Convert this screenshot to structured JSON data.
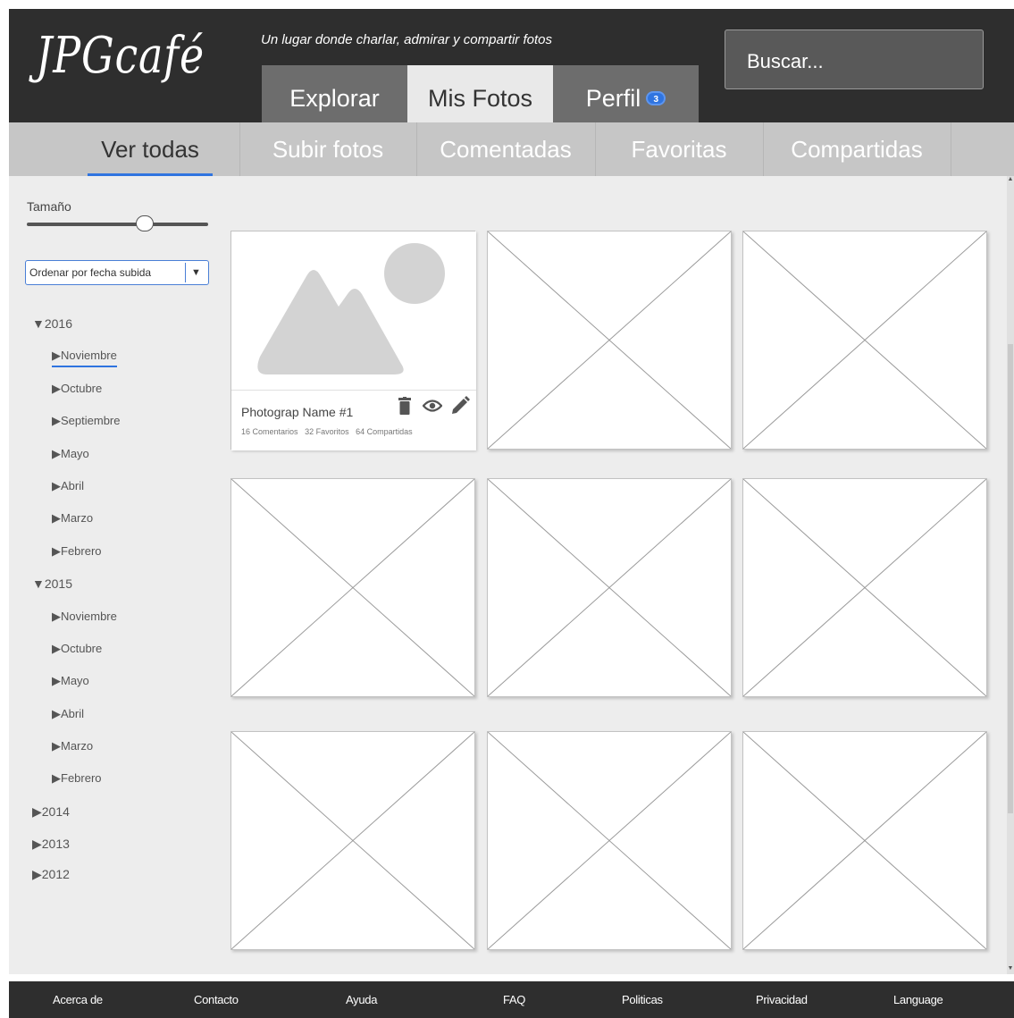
{
  "header": {
    "logo": "JPGcafé",
    "tagline": "Un lugar donde charlar, admirar y compartir fotos",
    "tabs": [
      {
        "label": "Explorar"
      },
      {
        "label": "Mis Fotos"
      },
      {
        "label": "Perfil",
        "badge": "3"
      }
    ],
    "active_tab": "Mis Fotos",
    "search": {
      "placeholder": "Buscar..."
    }
  },
  "subnav": {
    "tabs": [
      {
        "label": "Ver todas"
      },
      {
        "label": "Subir fotos"
      },
      {
        "label": "Comentadas"
      },
      {
        "label": "Favoritas"
      },
      {
        "label": "Compartidas"
      }
    ],
    "active": "Ver todas"
  },
  "sidebar": {
    "size_label": "Tamaño",
    "size_value": 0.65,
    "sort_label": "Ordenar por fecha subida",
    "tree": {
      "y2016": {
        "label": "▼2016",
        "months": [
          "▶Noviembre",
          "▶Octubre",
          "▶Septiembre",
          "▶Mayo",
          "▶Abril",
          "▶Marzo",
          "▶Febrero"
        ]
      },
      "y2015": {
        "label": "▼2015",
        "months": [
          "▶Noviembre",
          "▶Octubre",
          "▶Mayo",
          "▶Abril",
          "▶Marzo",
          "▶Febrero"
        ]
      },
      "y2014": {
        "label": "▶2014"
      },
      "y2013": {
        "label": "▶2013"
      },
      "y2012": {
        "label": "▶2012"
      }
    },
    "selected": "2016 Noviembre"
  },
  "photo": {
    "name": "Photograp Name #1",
    "stats": {
      "comments": "16 Comentarios",
      "favorites": "32 Favoritos",
      "shares": "64 Compartidas"
    },
    "icons": [
      "trash-icon",
      "eye-icon",
      "pencil-icon"
    ]
  },
  "footer": {
    "links": [
      "Acerca de",
      "Contacto",
      "Ayuda",
      "FAQ",
      "Politicas",
      "Privacidad",
      "Language"
    ]
  },
  "colors": {
    "header_bg": "#2e2e2e",
    "accent": "#2f74e0",
    "subnav_bg": "#c6c6c6",
    "content_bg": "#ededed"
  }
}
